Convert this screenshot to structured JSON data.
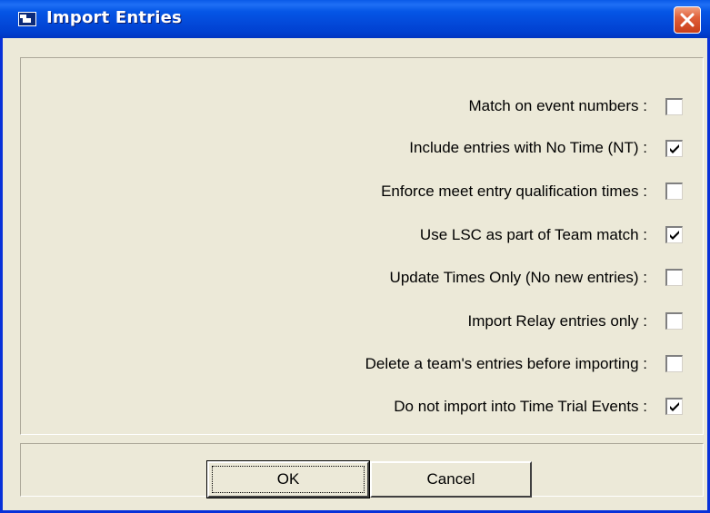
{
  "window": {
    "title": "Import Entries"
  },
  "options": [
    {
      "label": "Match on event numbers :",
      "checked": false
    },
    {
      "label": "Include entries with No Time (NT) :",
      "checked": true
    },
    {
      "label": "Enforce meet entry qualification times :",
      "checked": false
    },
    {
      "label": "Use LSC as part of Team match :",
      "checked": true
    },
    {
      "label": "Update Times Only (No new entries) :",
      "checked": false
    },
    {
      "label": "Import Relay entries only :",
      "checked": false
    },
    {
      "label": "Delete a team's entries before importing :",
      "checked": false
    },
    {
      "label": "Do not import into Time Trial Events :",
      "checked": true
    }
  ],
  "buttons": {
    "ok_label": "OK",
    "cancel_label": "Cancel"
  },
  "colors": {
    "titlebar": "#0349d9",
    "window_bg": "#ece9d8",
    "close_button": "#e0603a"
  },
  "icons": {
    "title": "window-app-icon",
    "close": "close-icon",
    "check": "checkmark-icon"
  }
}
